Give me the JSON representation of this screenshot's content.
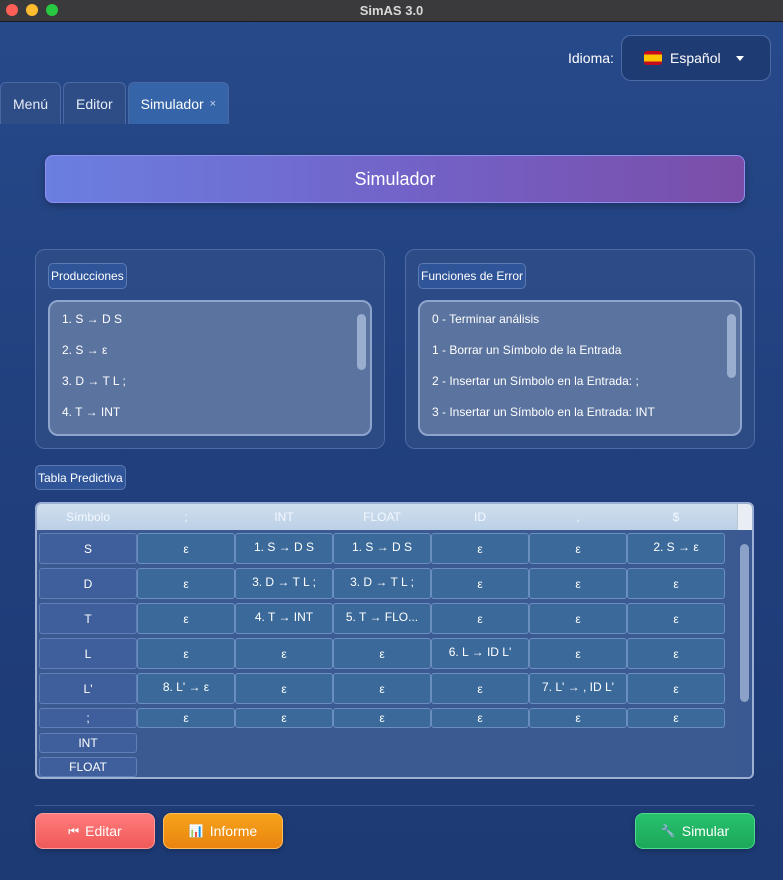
{
  "window": {
    "title": "SimAS 3.0"
  },
  "language": {
    "label": "Idioma:",
    "selected": "Español"
  },
  "tabs": [
    {
      "label": "Menú"
    },
    {
      "label": "Editor"
    },
    {
      "label": "Simulador",
      "close": "×"
    }
  ],
  "banner": {
    "title": "Simulador"
  },
  "productions": {
    "title": "Producciones",
    "items": [
      "1. S → D S",
      "2. S → ε",
      "3. D → T L ;",
      "4. T → INT"
    ]
  },
  "error_functions": {
    "title": "Funciones de Error",
    "items": [
      "0 - Terminar análisis",
      "1 - Borrar un Símbolo de la Entrada",
      "2 - Insertar un Símbolo en la Entrada: ;",
      "3 - Insertar un Símbolo en la Entrada: INT"
    ]
  },
  "table": {
    "title": "Tabla Predictiva",
    "headers": [
      "Símbolo",
      ";",
      "INT",
      "FLOAT",
      "ID",
      ",",
      "$"
    ],
    "rows": [
      {
        "symbol": "S",
        "cells": [
          "ε",
          "1. S → D S",
          "1. S → D S",
          "ε",
          "ε",
          "2. S → ε"
        ]
      },
      {
        "symbol": "D",
        "cells": [
          "ε",
          "3. D → T L ;",
          "3. D → T L ;",
          "ε",
          "ε",
          "ε"
        ]
      },
      {
        "symbol": "T",
        "cells": [
          "ε",
          "4. T → INT",
          "5. T → FLO...",
          "ε",
          "ε",
          "ε"
        ]
      },
      {
        "symbol": "L",
        "cells": [
          "ε",
          "ε",
          "ε",
          "6. L → ID L'",
          "ε",
          "ε"
        ]
      },
      {
        "symbol": "L'",
        "cells": [
          "8. L' → ε",
          "ε",
          "ε",
          "ε",
          "7. L' → , ID L'",
          "ε"
        ]
      },
      {
        "symbol": ";",
        "cells": [
          "ε",
          "ε",
          "ε",
          "ε",
          "ε",
          "ε"
        ]
      },
      {
        "symbol": "INT",
        "cells": []
      },
      {
        "symbol": "FLOAT",
        "cells": []
      }
    ]
  },
  "buttons": {
    "edit": {
      "icon": "⏮",
      "label": "Editar"
    },
    "report": {
      "icon": "📊",
      "label": "Informe"
    },
    "simulate": {
      "icon": "🔧",
      "label": "Simular"
    }
  }
}
